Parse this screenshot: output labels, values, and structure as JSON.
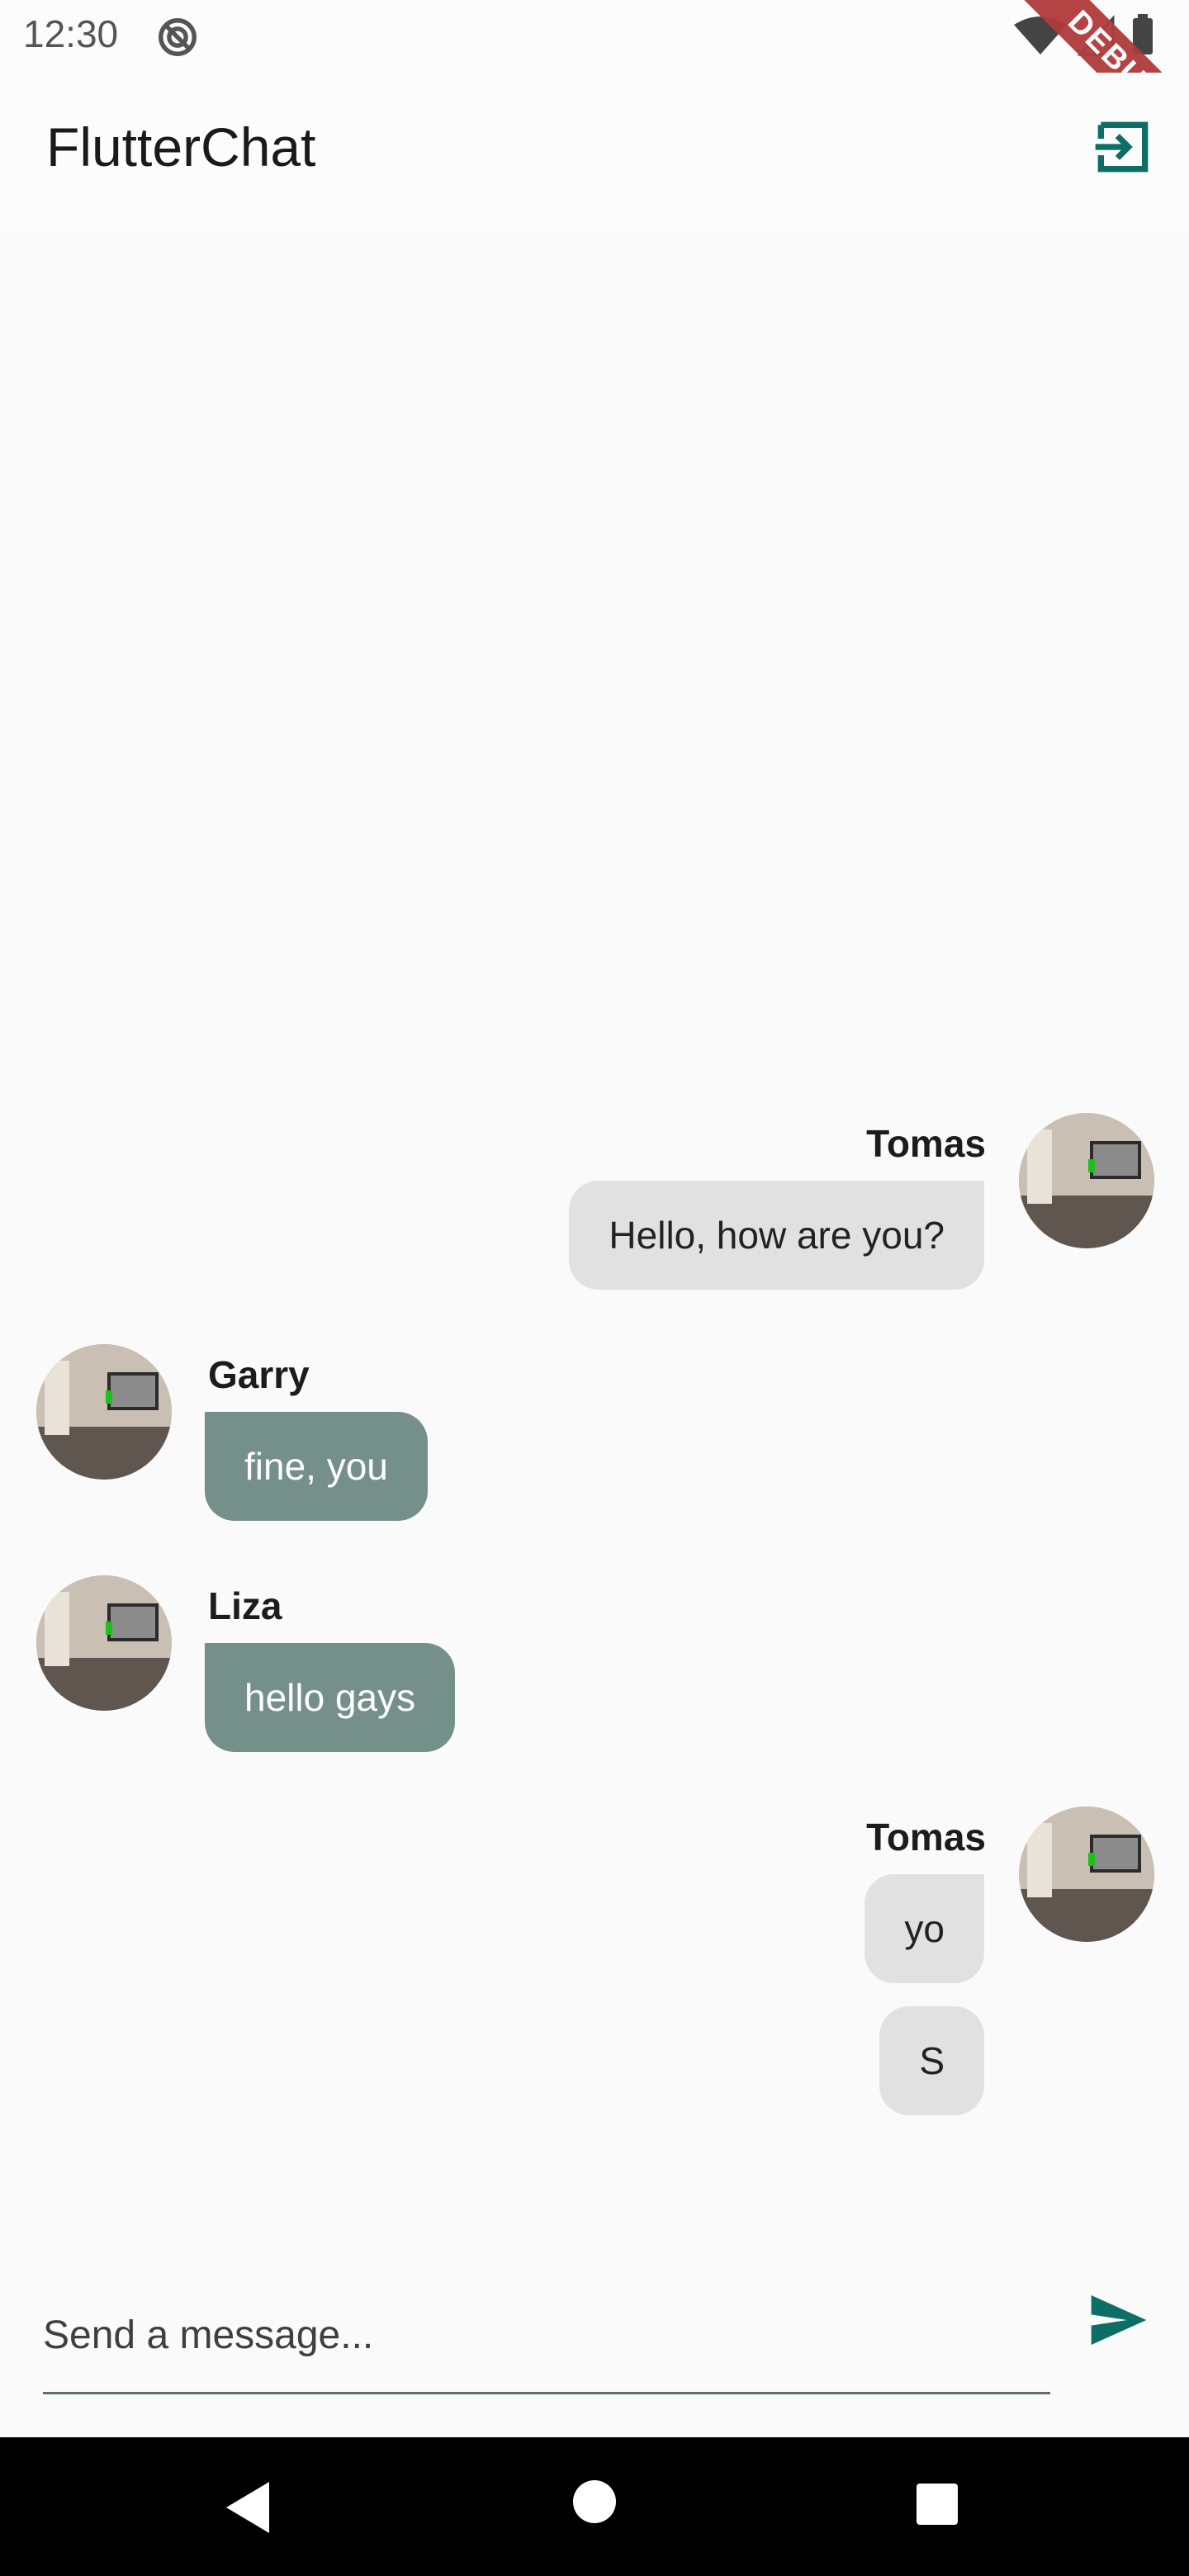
{
  "status_bar": {
    "time": "12:30",
    "debug_label": "DEBUG",
    "icons": [
      "sync-off-icon",
      "wifi-icon",
      "signal-icon",
      "battery-icon"
    ]
  },
  "app_bar": {
    "title": "FlutterChat",
    "logout_icon": "logout-icon"
  },
  "messages": [
    {
      "sender": "Tomas",
      "text": "Hello, how are you?",
      "mine": true,
      "show_avatar": true
    },
    {
      "sender": "Garry",
      "text": "fine, you",
      "mine": false,
      "show_avatar": true
    },
    {
      "sender": "Liza",
      "text": "hello gays",
      "mine": false,
      "show_avatar": true
    },
    {
      "sender": "Tomas",
      "text": "yo",
      "mine": true,
      "show_avatar": true
    },
    {
      "sender": "",
      "text": "S",
      "mine": true,
      "show_avatar": false
    }
  ],
  "composer": {
    "placeholder": "Send a message...",
    "send_icon": "send-icon"
  },
  "colors": {
    "accent": "#0d6e66",
    "other_bubble": "#75908a",
    "mine_bubble": "#e1e1e1",
    "background": "#fafafa"
  },
  "nav_bar": {
    "icons": [
      "back-icon",
      "home-icon",
      "recent-apps-icon"
    ]
  }
}
